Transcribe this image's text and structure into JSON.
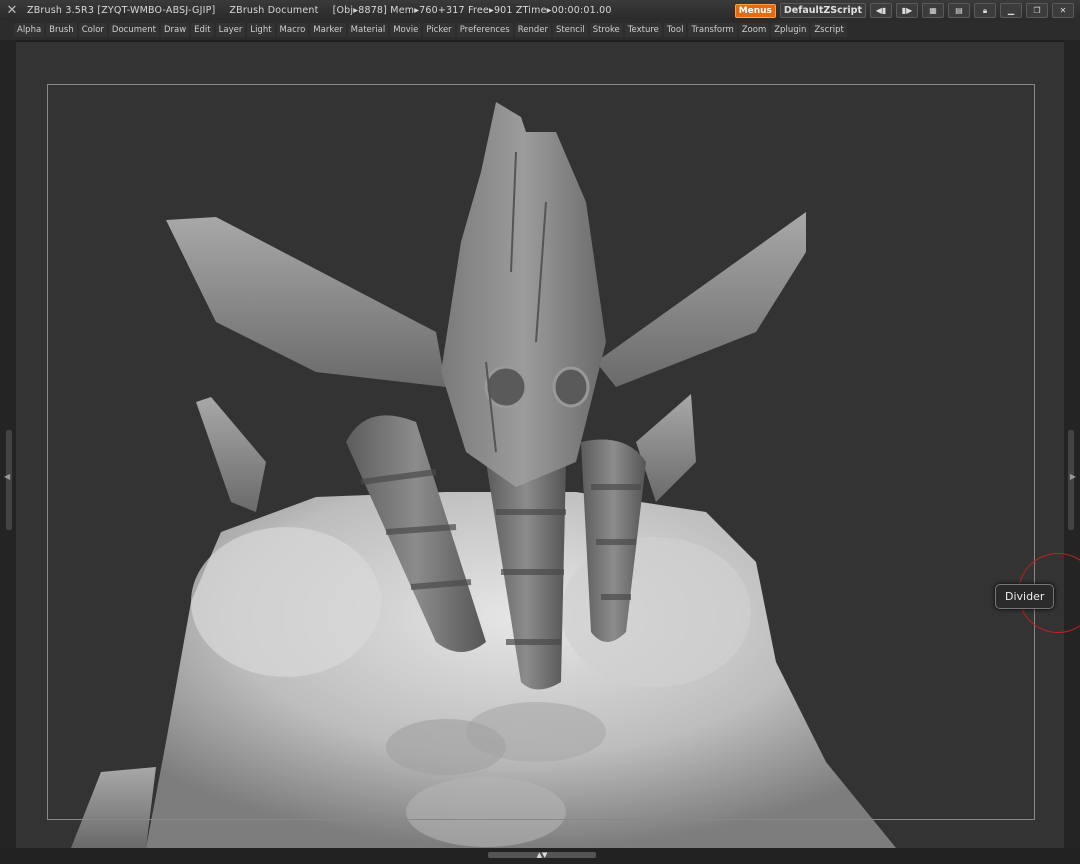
{
  "titlebar": {
    "app": "ZBrush 3.5R3 [ZYQT-WMBO-ABSJ-GJIP]",
    "document": "ZBrush Document",
    "stats": "[Obj▸8878] Mem▸760+317 Free▸901 ZTime▸00:00:01.00",
    "menus_button": "Menus",
    "script_button": "DefaultZScript",
    "icons": [
      "quicksave-icon",
      "dock-icon",
      "layout-icon",
      "layout2-icon",
      "lock-icon",
      "minimize-icon",
      "restore-icon",
      "close-icon"
    ]
  },
  "menubar": {
    "items": [
      "Alpha",
      "Brush",
      "Color",
      "Document",
      "Draw",
      "Edit",
      "Layer",
      "Light",
      "Macro",
      "Marker",
      "Material",
      "Movie",
      "Picker",
      "Preferences",
      "Render",
      "Stencil",
      "Stroke",
      "Texture",
      "Tool",
      "Transform",
      "Zoom",
      "Zplugin",
      "Zscript"
    ]
  },
  "canvas": {
    "subject": "sculpted-creature-model",
    "tooltip": "Divider"
  },
  "colors": {
    "accent": "#e66a10",
    "canvas_bg": "#333333",
    "frame": "#888888",
    "cursor_ring": "#c02020"
  }
}
